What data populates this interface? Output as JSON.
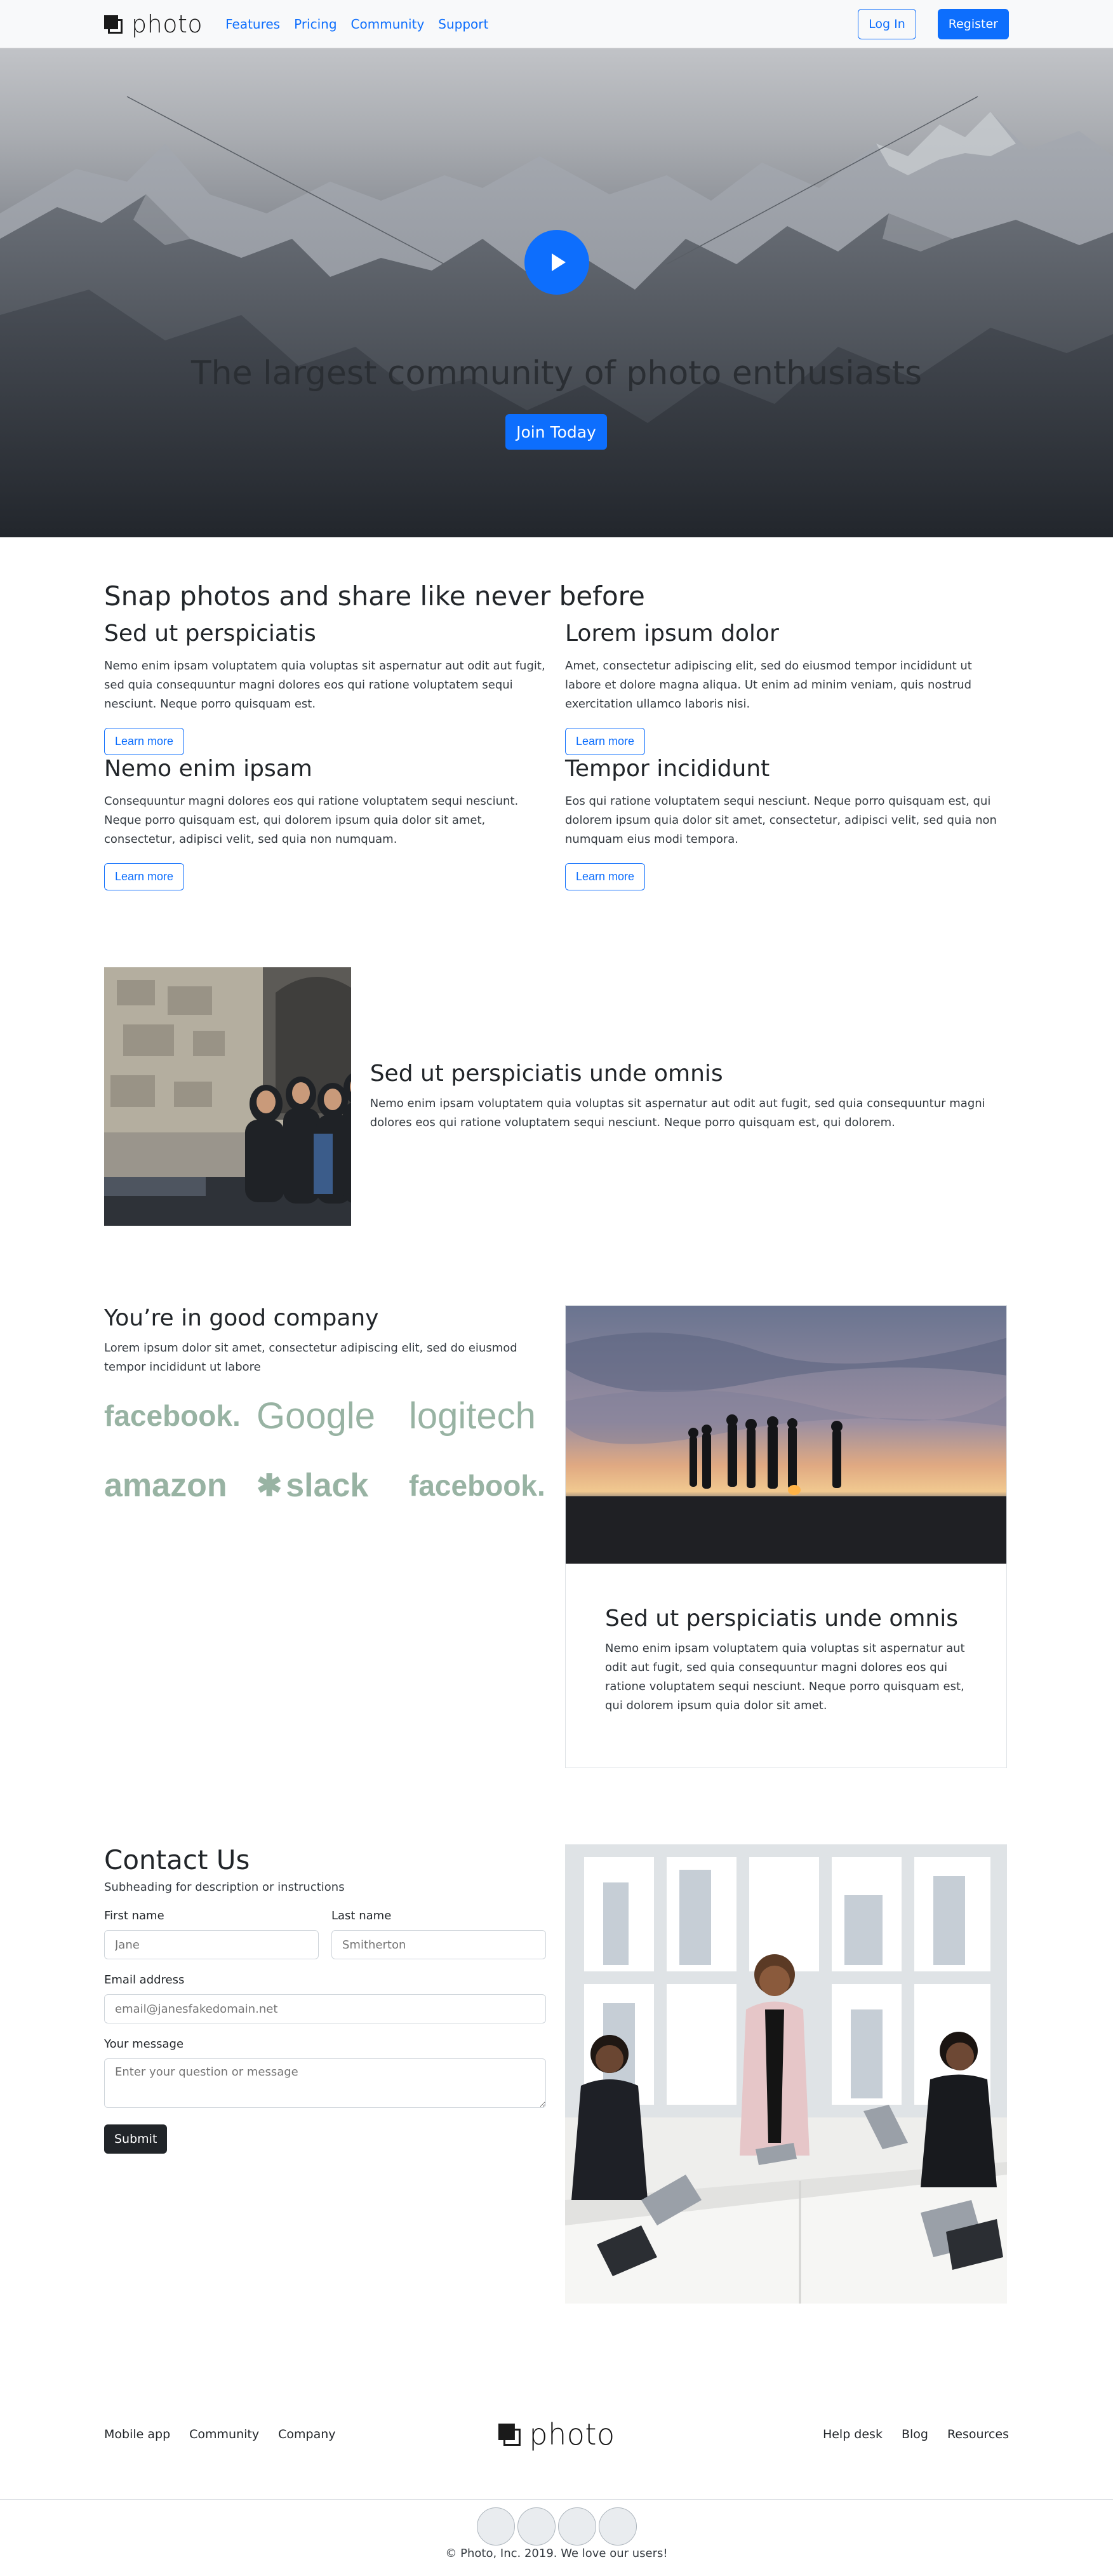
{
  "brand": {
    "name": "photo"
  },
  "nav": {
    "links": [
      "Features",
      "Pricing",
      "Community",
      "Support"
    ],
    "login_label": "Log In",
    "register_label": "Register"
  },
  "hero": {
    "title": "The largest community of photo enthusiasts",
    "cta_label": "Join Today"
  },
  "features": {
    "title": "Snap photos and share like never before",
    "items": [
      {
        "heading": "Sed ut perspiciatis",
        "text": "Nemo enim ipsam voluptatem quia voluptas sit aspernatur aut odit aut fugit, sed quia consequuntur magni dolores eos qui ratione voluptatem sequi nesciunt. Neque porro quisquam est.",
        "button": "Learn more"
      },
      {
        "heading": "Lorem ipsum dolor",
        "text": "Amet, consectetur adipiscing elit, sed do eiusmod tempor incididunt ut labore et dolore magna aliqua. Ut enim ad minim veniam, quis nostrud exercitation ullamco laboris nisi.",
        "button": "Learn more"
      },
      {
        "heading": "Nemo enim ipsam",
        "text": "Consequuntur magni dolores eos qui ratione voluptatem sequi nesciunt. Neque porro quisquam est, qui dolorem ipsum quia dolor sit amet, consectetur, adipisci velit, sed quia non numquam.",
        "button": "Learn more"
      },
      {
        "heading": "Tempor incididunt",
        "text": "Eos qui ratione voluptatem sequi nesciunt. Neque porro quisquam est, qui dolorem ipsum quia dolor sit amet, consectetur, adipisci velit, sed quia non numquam eius modi tempora.",
        "button": "Learn more"
      }
    ]
  },
  "feature_row": {
    "heading": "Sed ut perspiciatis unde omnis",
    "text": "Nemo enim ipsam voluptatem quia voluptas sit aspernatur aut odit aut fugit, sed quia consequuntur magni dolores eos qui ratione voluptatem sequi nesciunt. Neque porro quisquam est, qui dolorem."
  },
  "company": {
    "heading": "You’re in good company",
    "text": "Lorem ipsum dolor sit amet, consectetur adipiscing elit, sed do eiusmod tempor incididunt ut labore",
    "logos": [
      "facebook.",
      "Google",
      "logitech",
      "amazon",
      "slack",
      "facebook."
    ],
    "logo_color": "#98b3a3",
    "card": {
      "heading": "Sed ut perspiciatis unde omnis",
      "text": "Nemo enim ipsam voluptatem quia voluptas sit aspernatur aut odit aut fugit, sed quia consequuntur magni dolores eos qui ratione voluptatem sequi nesciunt. Neque porro quisquam est, qui dolorem ipsum quia dolor sit amet."
    }
  },
  "contact": {
    "title": "Contact Us",
    "subtitle": "Subheading for description or instructions",
    "first_name": {
      "label": "First name",
      "placeholder": "Jane"
    },
    "last_name": {
      "label": "Last name",
      "placeholder": "Smitherton"
    },
    "email": {
      "label": "Email address",
      "placeholder": "email@janesfakedomain.net"
    },
    "message": {
      "label": "Your message",
      "placeholder": "Enter your question or message"
    },
    "submit_label": "Submit"
  },
  "footer": {
    "left_links": [
      "Mobile app",
      "Community",
      "Company"
    ],
    "right_links": [
      "Help desk",
      "Blog",
      "Resources"
    ],
    "copyright": "© Photo, Inc. 2019. We love our users!"
  },
  "colors": {
    "primary": "#0d6efd",
    "dark": "#212529",
    "light": "#f8f9fa"
  },
  "icons": [
    "play-icon",
    "brand-logo-icon",
    "social-icon"
  ]
}
